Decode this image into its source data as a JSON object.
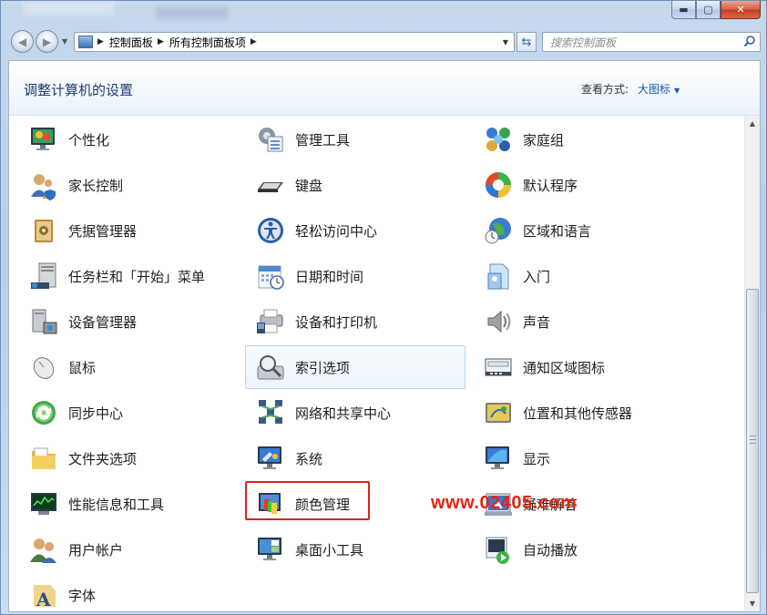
{
  "window": {
    "caption": {
      "minimize": "▬",
      "maximize": "▢",
      "close": "✕"
    }
  },
  "nav": {
    "breadcrumb": [
      "控制面板",
      "所有控制面板项"
    ],
    "search_placeholder": "搜索控制面板"
  },
  "header": {
    "title": "调整计算机的设置",
    "view_by_label": "查看方式:",
    "view_by_value": "大图标"
  },
  "items": {
    "c0": [
      "个性化",
      "家长控制",
      "凭据管理器",
      "任务栏和「开始」菜单",
      "设备管理器",
      "鼠标",
      "同步中心",
      "文件夹选项",
      "性能信息和工具",
      "用户帐户",
      "字体"
    ],
    "c1": [
      "管理工具",
      "键盘",
      "轻松访问中心",
      "日期和时间",
      "设备和打印机",
      "索引选项",
      "网络和共享中心",
      "系统",
      "颜色管理",
      "桌面小工具"
    ],
    "c2": [
      "家庭组",
      "默认程序",
      "区域和语言",
      "入门",
      "声音",
      "通知区域图标",
      "位置和其他传感器",
      "显示",
      "疑难解答",
      "自动播放"
    ]
  },
  "icons": {
    "c0": [
      "personalization-icon",
      "parental-controls-icon",
      "credential-manager-icon",
      "taskbar-icon",
      "device-manager-icon",
      "mouse-icon",
      "sync-center-icon",
      "folder-options-icon",
      "performance-icon",
      "user-accounts-icon",
      "fonts-icon"
    ],
    "c1": [
      "admin-tools-icon",
      "keyboard-icon",
      "ease-of-access-icon",
      "date-time-icon",
      "devices-printers-icon",
      "indexing-options-icon",
      "network-sharing-icon",
      "system-icon",
      "color-management-icon",
      "desktop-gadgets-icon"
    ],
    "c2": [
      "homegroup-icon",
      "default-programs-icon",
      "region-language-icon",
      "getting-started-icon",
      "sound-icon",
      "notification-icons-icon",
      "location-sensors-icon",
      "display-icon",
      "troubleshooting-icon",
      "autoplay-icon"
    ]
  },
  "hovered_item": "索引选项",
  "highlighted_item": "颜色管理",
  "watermark": "www.02405.com",
  "colors": {
    "accent": "#1a56b0",
    "highlight_box": "#e02020",
    "watermark": "#e8230f"
  }
}
